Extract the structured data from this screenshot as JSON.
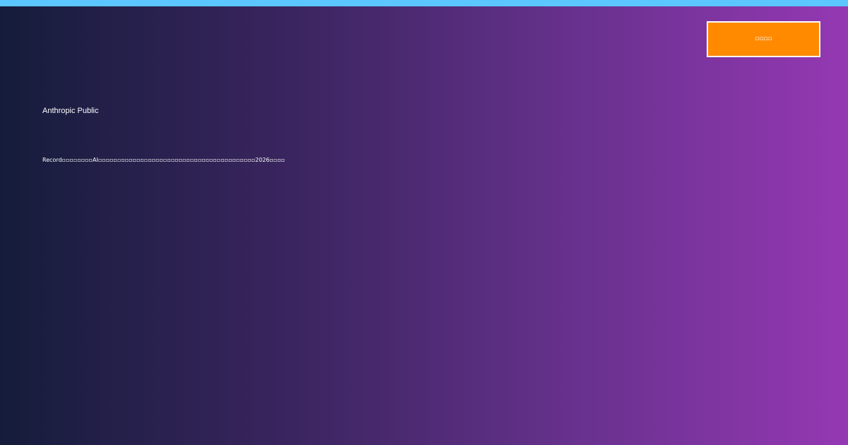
{
  "header": {
    "accent_stripe_color": "#5cc6ff"
  },
  "cta": {
    "label": "▫▫▫▫",
    "color": "#ff8a00"
  },
  "brand": {
    "text": "Anthropic Public"
  },
  "headline": {
    "text": "Record▫▫▫▫▫▫▫▫AI▫▫▫▫▫▫▫▫▫▫▫▫▫▫▫▫▫▫▫▫▫▫▫▫▫▫▫▫▫▫▫▫▫▫▫▫▫▫▫▫▫2026▫▫▫▫"
  }
}
